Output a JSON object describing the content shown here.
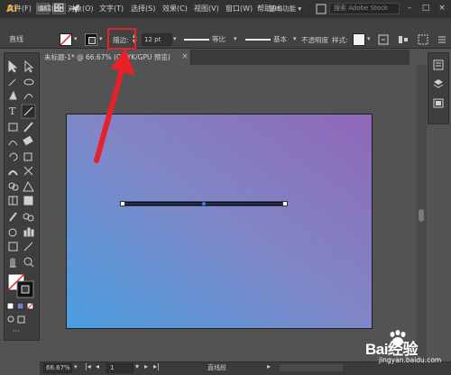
{
  "app": {
    "logo": "Ai",
    "badge_st": "St",
    "menu": [
      "文件(F)",
      "编辑(E)",
      "对象(O)",
      "文字(T)",
      "选择(S)",
      "效果(C)",
      "视图(V)",
      "窗口(W)",
      "帮助(H)"
    ],
    "workspace": "基本功能",
    "search_placeholder": "搜索 Adobe Stock"
  },
  "control_bar": {
    "object_type": "直线",
    "stroke_label": "描边:",
    "stroke_weight": "12 pt",
    "profile_label": "等比",
    "brush_label": "基本",
    "opacity_label": "不透明度",
    "style_label": "样式:"
  },
  "document": {
    "tab_title": "未标题-1* @ 66.67% (CMYK/GPU 预览)",
    "close": "×"
  },
  "status_bar": {
    "zoom": "66.67%",
    "page": "1",
    "tool_name": "直线段"
  },
  "watermark": {
    "brand": "Bai经验",
    "url": "jingyan.baidu.com"
  },
  "colors": {
    "annotation": "#e8202a",
    "gradient_start": "#4a9fe0",
    "gradient_end": "#8f67b8"
  }
}
